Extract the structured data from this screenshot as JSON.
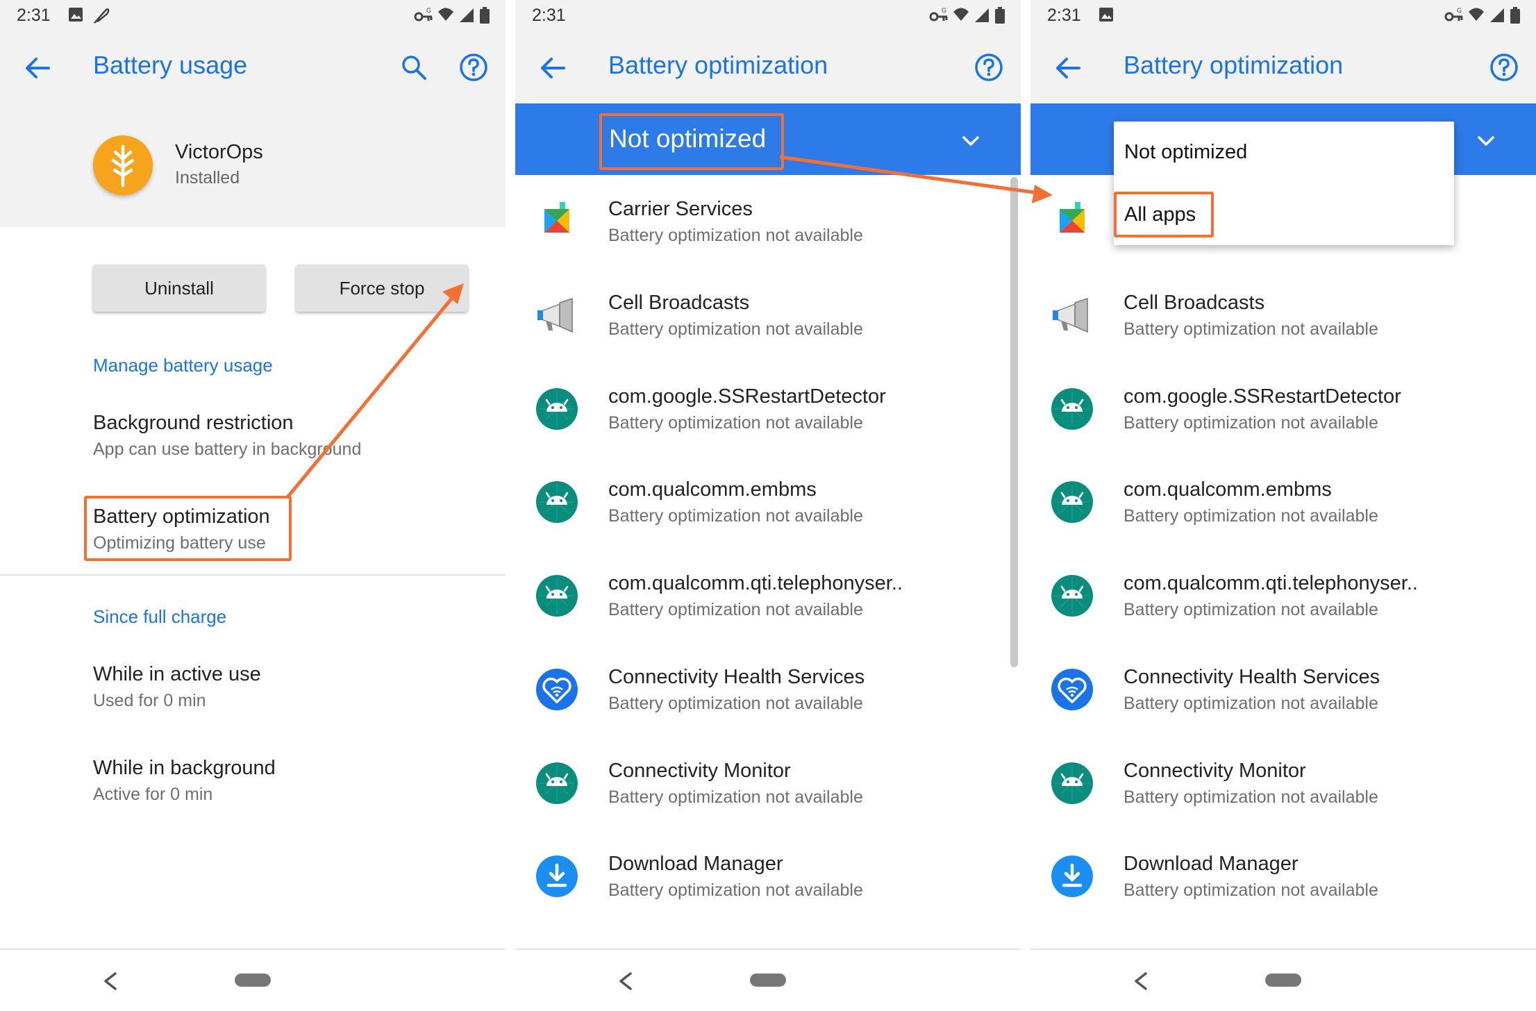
{
  "colors": {
    "accent": "#1a73e8",
    "callout": "#f37035",
    "spinner_bar": "#2d7be8",
    "app_icon": "#f7a41d"
  },
  "panel1": {
    "status": {
      "time": "2:31",
      "icons": [
        "image-icon",
        "feather-icon",
        "vpn-key-icon",
        "wifi-icon",
        "signal-icon",
        "battery-icon"
      ]
    },
    "title": "Battery usage",
    "app": {
      "name": "VictorOps",
      "status": "Installed",
      "icon": "victorops-logo-icon"
    },
    "buttons": {
      "uninstall": "Uninstall",
      "force_stop": "Force stop"
    },
    "manage_header": "Manage battery usage",
    "background_restriction": {
      "title": "Background restriction",
      "summary": "App can use battery in background"
    },
    "battery_optimization": {
      "title": "Battery optimization",
      "summary": "Optimizing battery use"
    },
    "since_header": "Since full charge",
    "active_use": {
      "title": "While in active use",
      "summary": "Used for 0 min"
    },
    "background_use": {
      "title": "While in background",
      "summary": "Active for 0 min"
    }
  },
  "panel2": {
    "status": {
      "time": "2:31",
      "icons": [
        "vpn-key-icon",
        "wifi-icon",
        "signal-icon",
        "battery-icon"
      ]
    },
    "title": "Battery optimization",
    "filter": "Not optimized",
    "summary": "Battery optimization not available",
    "apps": [
      {
        "name": "Carrier Services",
        "icon": "play-services-icon"
      },
      {
        "name": "Cell Broadcasts",
        "icon": "megaphone-icon"
      },
      {
        "name": "com.google.SSRestartDetector",
        "icon": "android-icon"
      },
      {
        "name": "com.qualcomm.embms",
        "icon": "android-icon"
      },
      {
        "name": "com.qualcomm.qti.telephonyser..",
        "icon": "android-icon"
      },
      {
        "name": "Connectivity Health Services",
        "icon": "wifi-heart-icon"
      },
      {
        "name": "Connectivity Monitor",
        "icon": "android-icon"
      },
      {
        "name": "Download Manager",
        "icon": "download-icon"
      }
    ]
  },
  "panel3": {
    "status": {
      "time": "2:31",
      "icons": [
        "image-icon",
        "vpn-key-icon",
        "wifi-icon",
        "signal-icon",
        "battery-icon"
      ]
    },
    "title": "Battery optimization",
    "menu": {
      "option_not_optimized": "Not optimized",
      "option_all_apps": "All apps"
    },
    "summary": "Battery optimization not available",
    "apps": [
      {
        "name": "",
        "icon": "play-services-icon"
      },
      {
        "name": "Cell Broadcasts",
        "icon": "megaphone-icon"
      },
      {
        "name": "com.google.SSRestartDetector",
        "icon": "android-icon"
      },
      {
        "name": "com.qualcomm.embms",
        "icon": "android-icon"
      },
      {
        "name": "com.qualcomm.qti.telephonyser..",
        "icon": "android-icon"
      },
      {
        "name": "Connectivity Health Services",
        "icon": "wifi-heart-icon"
      },
      {
        "name": "Connectivity Monitor",
        "icon": "android-icon"
      },
      {
        "name": "Download Manager",
        "icon": "download-icon"
      }
    ]
  }
}
